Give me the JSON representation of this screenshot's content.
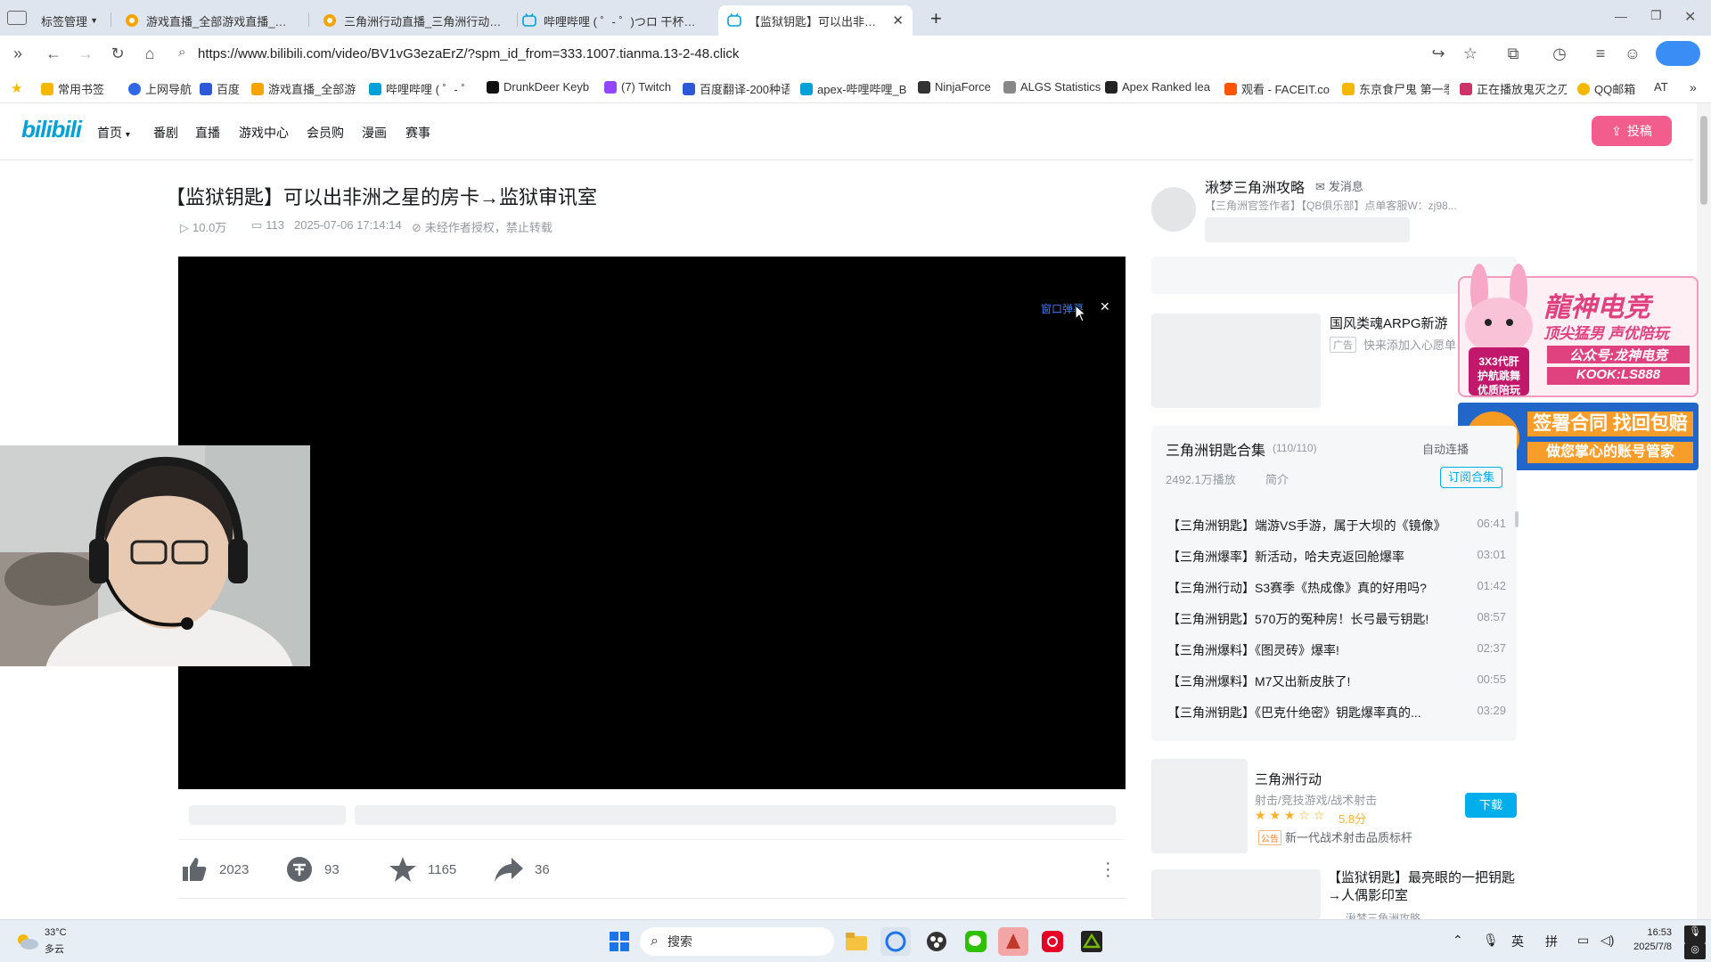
{
  "browser": {
    "tabs": [
      {
        "label": "标签管理",
        "icon": "tab-manager-icon"
      },
      {
        "label": "游戏直播_全部游戏直播_斗鱼直播",
        "icon": "douyu-icon"
      },
      {
        "label": "三角洲行动直播_三角洲行动直播",
        "icon": "douyu-icon"
      },
      {
        "label": "哔哩哔哩 ( ゜- ゜)つロ 干杯~-bilibili",
        "icon": "bilibili-icon"
      },
      {
        "label": "【监狱钥匙】可以出非洲之星的房卡",
        "icon": "bilibili-icon"
      }
    ],
    "url": "https://www.bilibili.com/video/BV1vG3ezaErZ/?spm_id_from=333.1007.tianma.13-2-48.click",
    "bookmarks": [
      "常用书签",
      "上网导航",
      "百度",
      "游戏直播_全部游戏",
      "哔哩哔哩 ( ゜- ゜)つ",
      "DrunkDeer Keyb",
      "(7) Twitch",
      "百度翻译-200种语",
      "apex-哔哩哔哩_B",
      "NinjaForce",
      "ALGS Statistics",
      "Apex Ranked lea",
      "观看 - FACEIT.co",
      "东京食尸鬼 第一季",
      "正在播放鬼灭之刃",
      "QQ邮箱",
      "AT"
    ]
  },
  "site": {
    "logo": "bilibili",
    "nav": [
      "首页",
      "番剧",
      "直播",
      "游戏中心",
      "会员购",
      "漫画",
      "赛事"
    ],
    "upload_label": "投稿"
  },
  "video": {
    "title": "【监狱钥匙】可以出非洲之星的房卡→监狱审讯室",
    "views": "10.0万",
    "danmaku": "113",
    "date": "2025-07-06 17:14:14",
    "copyright": "未经作者授权，禁止转载",
    "popup_label": "窗口弹幕",
    "likes": "2023",
    "coins": "93",
    "favorites": "1165",
    "shares": "36"
  },
  "uploader": {
    "name": "湫梦三角洲攻略",
    "message_label": "发消息",
    "desc": "【三角洲官签作者】【QB俱乐部】点单客服W：zj98..."
  },
  "ad": {
    "title": "国风类魂ARPG新游",
    "tag": "广告",
    "desc": "快来添加入心愿单",
    "overlay_lines": [
      "龍神电竞",
      "顶尖猛男 声优陪玩",
      "公众号:龙神电竞",
      "KOOK:LS888",
      "3X3代肝",
      "护航跳舞",
      "优质陪玩",
      "签署合同 找回包赔",
      "做您掌心的账号管家"
    ]
  },
  "collection": {
    "title": "三角洲钥匙合集",
    "count": "(110/110)",
    "autoplay": "自动连播",
    "plays": "2492.1万播放",
    "intro": "简介",
    "subscribe": "订阅合集",
    "items": [
      {
        "title": "【三角洲钥匙】端游VS手游，属于大坝的《镜像》",
        "dur": "06:41"
      },
      {
        "title": "【三角洲爆率】新活动，哈夫克返回舱爆率",
        "dur": "03:01"
      },
      {
        "title": "【三角洲行动】S3赛季《热成像》真的好用吗?",
        "dur": "01:42"
      },
      {
        "title": "【三角洲钥匙】570万的冤种房！长弓最亏钥匙!",
        "dur": "08:57"
      },
      {
        "title": "【三角洲爆料】《图灵砖》爆率!",
        "dur": "02:37"
      },
      {
        "title": "【三角洲爆料】M7又出新皮肤了!",
        "dur": "00:55"
      },
      {
        "title": "【三角洲钥匙】《巴克什绝密》钥匙爆率真的...",
        "dur": "03:29"
      }
    ]
  },
  "game_card": {
    "name": "三角洲行动",
    "genre": "射击/竞技游戏/战术射击",
    "rating": 3,
    "rating_max": 5,
    "score": "5.8分",
    "notice_tag": "公告",
    "notice": "新一代战术射击品质标杆",
    "download": "下载"
  },
  "rec": {
    "title": "【监狱钥匙】最亮眼的一把钥匙→人偶影印室",
    "author": "湫梦三角洲攻略"
  },
  "taskbar": {
    "temp": "33°C",
    "weather": "多云",
    "search": "搜索",
    "ime1": "英",
    "ime2": "拼",
    "time": "16:53",
    "date": "2025/7/8"
  }
}
